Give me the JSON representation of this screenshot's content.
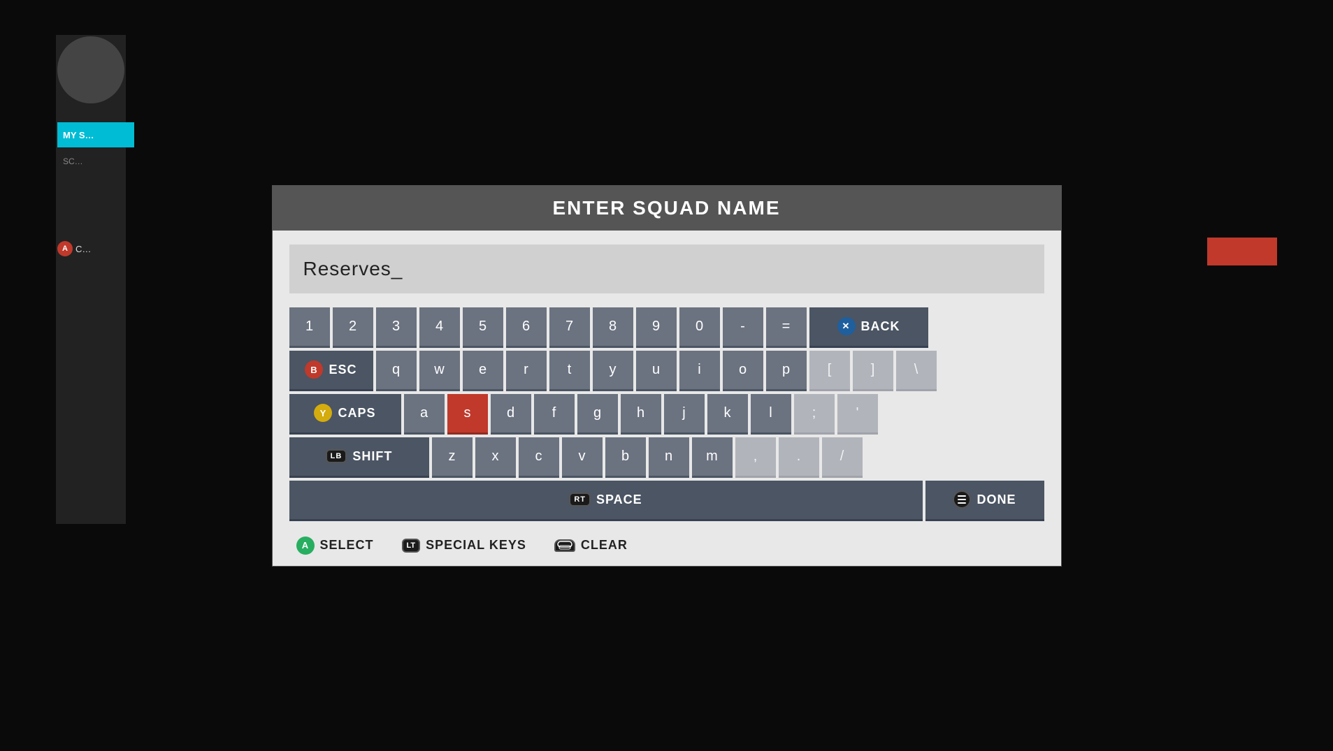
{
  "dialog": {
    "title": "ENTER SQUAD NAME",
    "input_value": "Reserves_"
  },
  "keyboard": {
    "rows": [
      {
        "id": "number-row",
        "keys": [
          {
            "id": "1",
            "label": "1",
            "type": "normal"
          },
          {
            "id": "2",
            "label": "2",
            "type": "normal"
          },
          {
            "id": "3",
            "label": "3",
            "type": "normal"
          },
          {
            "id": "4",
            "label": "4",
            "type": "normal"
          },
          {
            "id": "5",
            "label": "5",
            "type": "normal"
          },
          {
            "id": "6",
            "label": "6",
            "type": "normal"
          },
          {
            "id": "7",
            "label": "7",
            "type": "normal"
          },
          {
            "id": "8",
            "label": "8",
            "type": "normal"
          },
          {
            "id": "9",
            "label": "9",
            "type": "normal"
          },
          {
            "id": "0",
            "label": "0",
            "type": "normal"
          },
          {
            "id": "minus",
            "label": "-",
            "type": "normal"
          },
          {
            "id": "equals",
            "label": "=",
            "type": "normal"
          },
          {
            "id": "back",
            "label": "BACK",
            "type": "back",
            "btn": "x"
          }
        ]
      },
      {
        "id": "qwerty-row",
        "keys": [
          {
            "id": "esc",
            "label": "ESC",
            "type": "esc",
            "btn": "b"
          },
          {
            "id": "q",
            "label": "q",
            "type": "normal"
          },
          {
            "id": "w",
            "label": "w",
            "type": "normal"
          },
          {
            "id": "e",
            "label": "e",
            "type": "normal"
          },
          {
            "id": "r",
            "label": "r",
            "type": "normal"
          },
          {
            "id": "t",
            "label": "t",
            "type": "normal"
          },
          {
            "id": "y",
            "label": "y",
            "type": "normal"
          },
          {
            "id": "u",
            "label": "u",
            "type": "normal"
          },
          {
            "id": "i",
            "label": "i",
            "type": "normal"
          },
          {
            "id": "o",
            "label": "o",
            "type": "normal"
          },
          {
            "id": "p",
            "label": "p",
            "type": "normal"
          },
          {
            "id": "bracket-open",
            "label": "[",
            "type": "normal"
          },
          {
            "id": "bracket-close",
            "label": "]",
            "type": "normal"
          },
          {
            "id": "backslash",
            "label": "\\",
            "type": "normal"
          }
        ]
      },
      {
        "id": "asdf-row",
        "keys": [
          {
            "id": "caps",
            "label": "CAPS",
            "type": "caps",
            "btn": "y"
          },
          {
            "id": "a",
            "label": "a",
            "type": "normal"
          },
          {
            "id": "s",
            "label": "s",
            "type": "active"
          },
          {
            "id": "d",
            "label": "d",
            "type": "normal"
          },
          {
            "id": "f",
            "label": "f",
            "type": "normal"
          },
          {
            "id": "g",
            "label": "g",
            "type": "normal"
          },
          {
            "id": "h",
            "label": "h",
            "type": "normal"
          },
          {
            "id": "j",
            "label": "j",
            "type": "normal"
          },
          {
            "id": "k",
            "label": "k",
            "type": "normal"
          },
          {
            "id": "l",
            "label": "l",
            "type": "normal"
          },
          {
            "id": "semicolon",
            "label": ";",
            "type": "placeholder"
          },
          {
            "id": "quote",
            "label": "'",
            "type": "placeholder"
          }
        ]
      },
      {
        "id": "zxcv-row",
        "keys": [
          {
            "id": "shift",
            "label": "SHIFT",
            "type": "shift",
            "btn": "lb"
          },
          {
            "id": "z",
            "label": "z",
            "type": "normal"
          },
          {
            "id": "x",
            "label": "x",
            "type": "normal"
          },
          {
            "id": "c",
            "label": "c",
            "type": "normal"
          },
          {
            "id": "v",
            "label": "v",
            "type": "normal"
          },
          {
            "id": "b",
            "label": "b",
            "type": "normal"
          },
          {
            "id": "n",
            "label": "n",
            "type": "normal"
          },
          {
            "id": "m",
            "label": "m",
            "type": "normal"
          },
          {
            "id": "comma",
            "label": ",",
            "type": "placeholder"
          },
          {
            "id": "period",
            "label": ".",
            "type": "placeholder"
          },
          {
            "id": "slash",
            "label": "/",
            "type": "placeholder"
          }
        ]
      },
      {
        "id": "space-row",
        "keys": [
          {
            "id": "space",
            "label": "SPACE",
            "type": "space",
            "btn": "rt"
          },
          {
            "id": "done",
            "label": "DONE",
            "type": "done",
            "btn": "menu"
          }
        ]
      }
    ],
    "actions": [
      {
        "id": "select",
        "label": "SELECT",
        "btn": "a",
        "btn_color": "#27ae60"
      },
      {
        "id": "special-keys",
        "label": "SPECIAL KEYS",
        "btn": "lt"
      },
      {
        "id": "clear",
        "label": "CLEAR",
        "btn": "r1"
      }
    ]
  }
}
